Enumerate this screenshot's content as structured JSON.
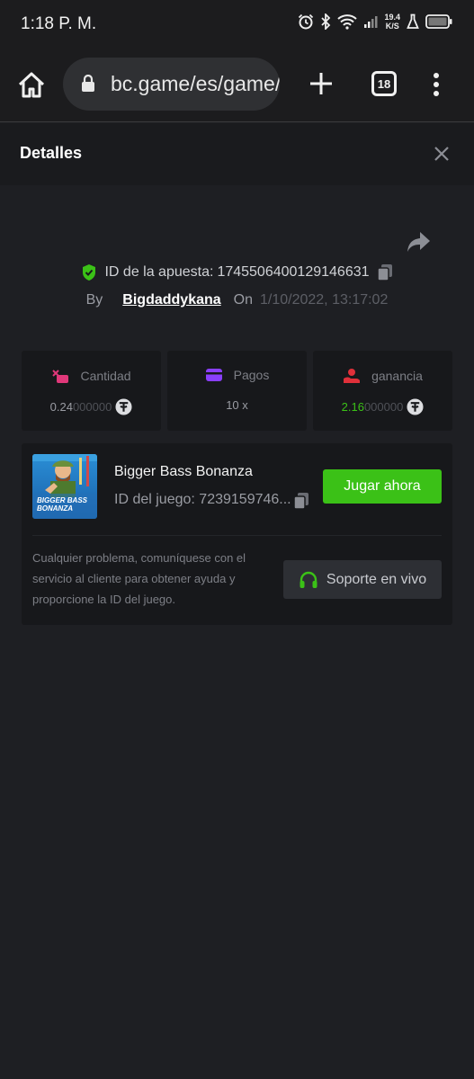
{
  "status_bar": {
    "time": "1:18 P. M.",
    "net_speed_value": "19.4",
    "net_speed_unit": "K/S"
  },
  "browser": {
    "url": "bc.game/es/game/slot/bigger-bass-bonanza",
    "tab_count": "18"
  },
  "header": {
    "title": "Detalles"
  },
  "bet": {
    "id_label": "ID de la apuesta:",
    "id_value": "1745506400129146631",
    "by_label": "By",
    "username": "Bigdaddykana",
    "on_label": "On",
    "datetime": "1/10/2022, 13:17:02"
  },
  "stats": [
    {
      "label": "Cantidad",
      "value_bright": "0.24",
      "value_dim": "000000",
      "icon": "coin-stack-icon",
      "color": "#e0387a"
    },
    {
      "label": "Pagos",
      "value": "10 x",
      "icon": "payout-card-icon",
      "color": "#8a3ffc"
    },
    {
      "label": "ganancia",
      "value_bright": "2.16",
      "value_dim": "000000",
      "icon": "profit-hand-icon",
      "color": "#e0303a"
    }
  ],
  "game": {
    "name": "Bigger Bass Bonanza",
    "id_label": "ID del juego:",
    "id_value": "7239159746...",
    "thumb_text_1": "BIGGER BASS",
    "thumb_text_2": "BONANZA",
    "play_label": "Jugar ahora",
    "help_text": "Cualquier problema, comuníquese con el servicio al cliente para obtener ayuda y proporcione la ID del juego.",
    "support_label": "Soporte en vivo"
  },
  "colors": {
    "accent_green": "#3bc117",
    "background": "#1e1f23",
    "card": "#17181b"
  }
}
